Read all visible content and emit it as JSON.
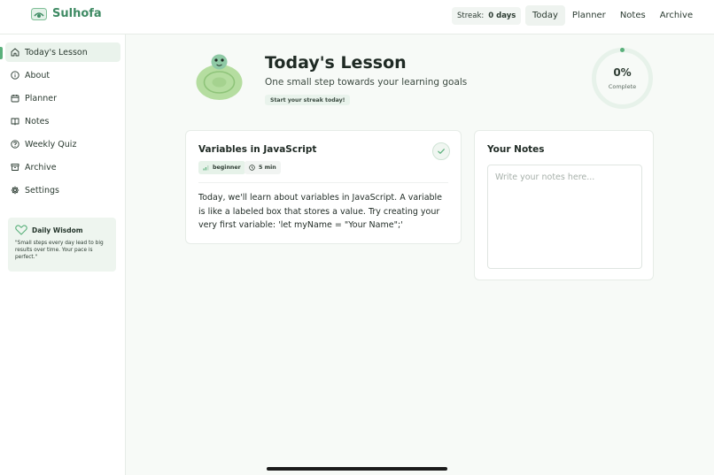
{
  "brand": {
    "name": "Sulhofa"
  },
  "header": {
    "streak_label": "Streak:",
    "streak_value": "0 days",
    "nav": [
      {
        "label": "Today",
        "active": true
      },
      {
        "label": "Planner",
        "active": false
      },
      {
        "label": "Notes",
        "active": false
      },
      {
        "label": "Archive",
        "active": false
      }
    ]
  },
  "sidebar": {
    "items": [
      {
        "label": "Today's Lesson",
        "icon": "home-icon",
        "active": true
      },
      {
        "label": "About",
        "icon": "info-icon",
        "active": false
      },
      {
        "label": "Planner",
        "icon": "calendar-icon",
        "active": false
      },
      {
        "label": "Notes",
        "icon": "book-icon",
        "active": false
      },
      {
        "label": "Weekly Quiz",
        "icon": "help-icon",
        "active": false
      },
      {
        "label": "Archive",
        "icon": "archive-icon",
        "active": false
      },
      {
        "label": "Settings",
        "icon": "gear-icon",
        "active": false
      }
    ],
    "wisdom": {
      "title": "Daily Wisdom",
      "text": "\"Small steps every day lead to big results over time. Your pace is perfect.\""
    }
  },
  "hero": {
    "title": "Today's Lesson",
    "subtitle": "One small step towards your learning goals",
    "chip": "Start your streak today!",
    "progress_percent": 0,
    "progress_text": "0%",
    "progress_label": "Complete"
  },
  "lesson": {
    "title": "Variables in JavaScript",
    "level": "beginner",
    "duration": "5 min",
    "body": "Today, we'll learn about variables in JavaScript. A variable is like a labeled box that stores a value. Try creating your very first variable: 'let myName = \"Your Name\";'",
    "completed": false
  },
  "notes": {
    "title": "Your Notes",
    "placeholder": "Write your notes here...",
    "value": ""
  },
  "colors": {
    "accent": "#5ab07b",
    "brand": "#3e8a63",
    "mascot": "#b5dda0"
  }
}
